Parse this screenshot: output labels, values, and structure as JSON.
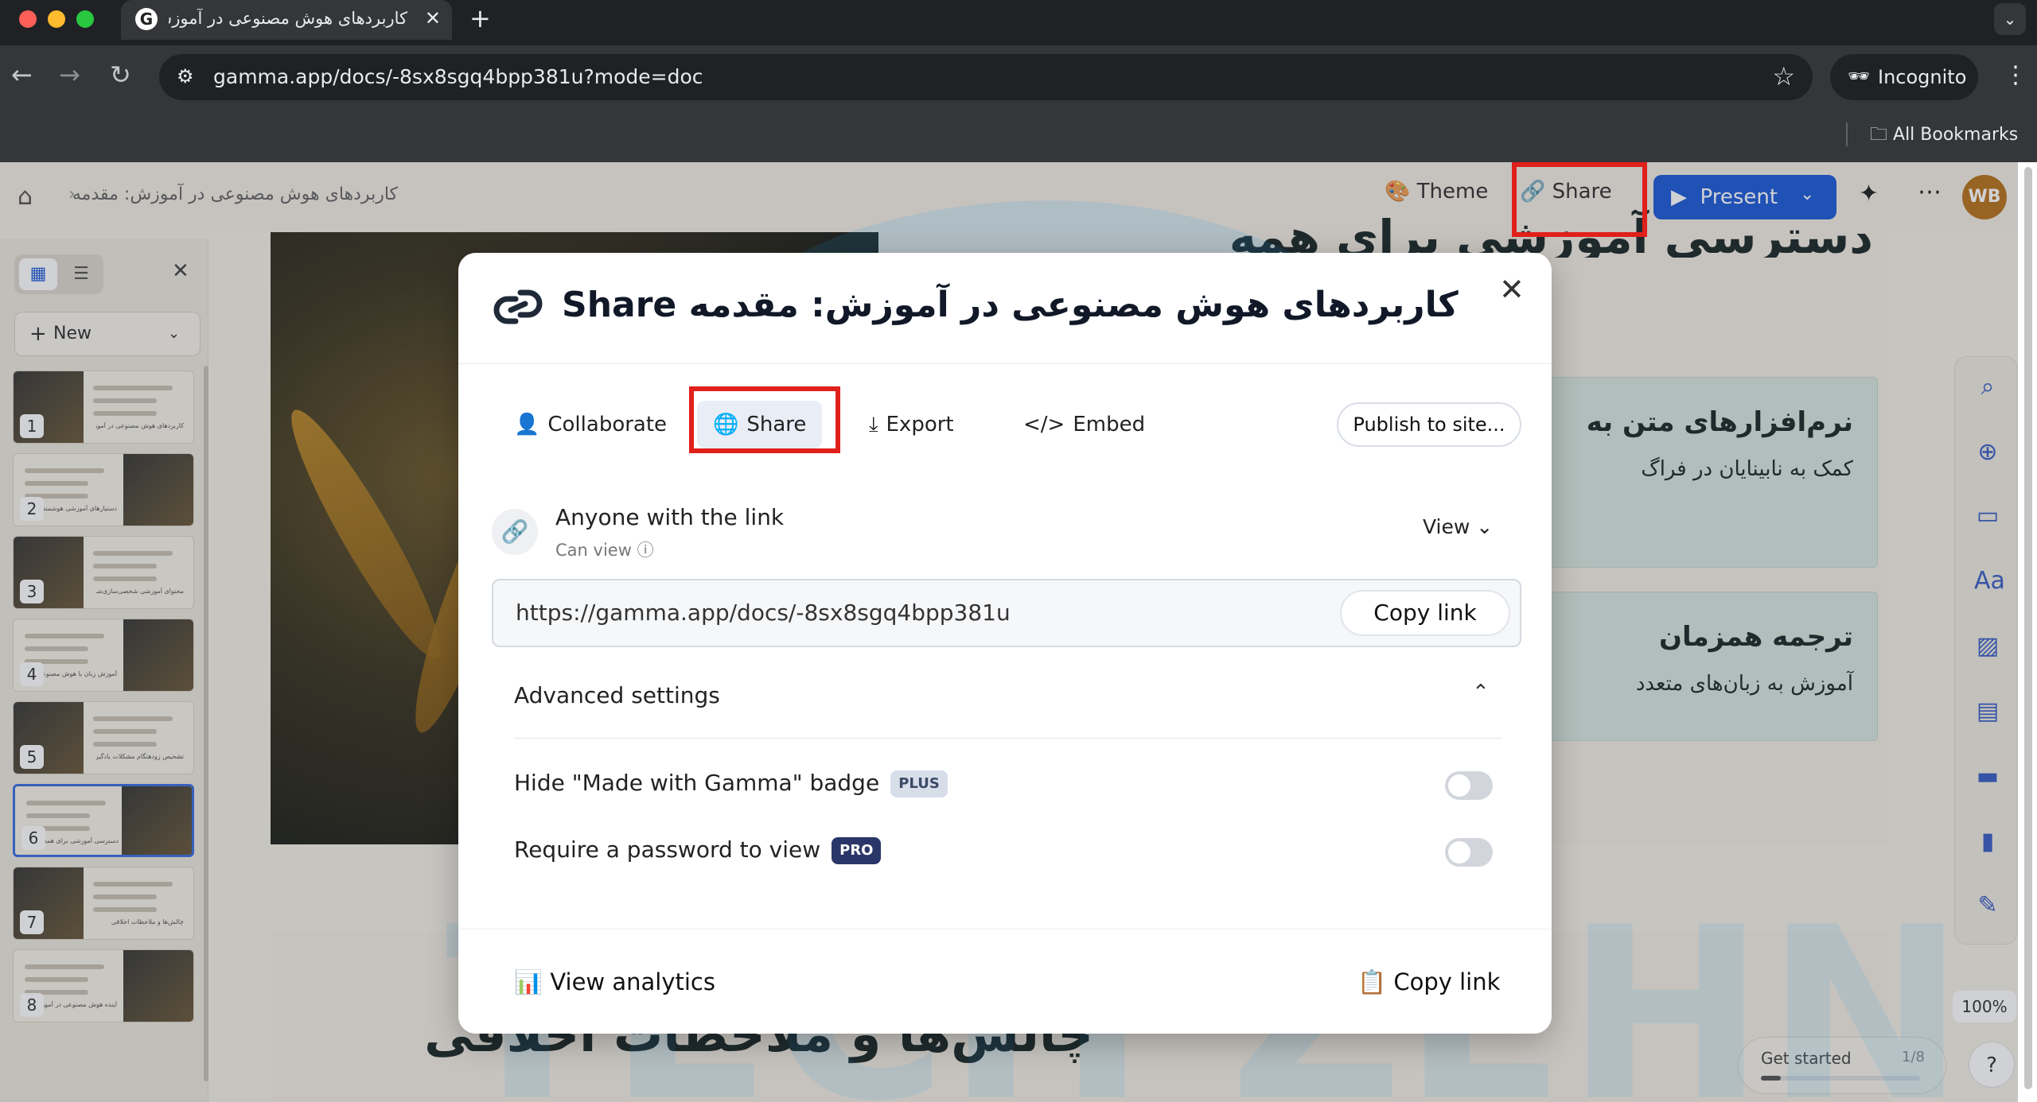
{
  "browser": {
    "tab_title": "کاربردهای هوش مصنوعی در آموزش: مقدمه",
    "tab_favicon": "G",
    "url": "gamma.app/docs/-8sx8sgq4bpp381u?mode=doc",
    "incognito_label": "Incognito",
    "bookmarks_label": "All Bookmarks"
  },
  "app": {
    "breadcrumb": "کاربردهای هوش مصنوعی در آموزش: مقدمه",
    "theme_label": "Theme",
    "share_label": "Share",
    "present_label": "Present",
    "avatar_initials": "WB",
    "zoom": "100%",
    "get_started_label": "Get started",
    "get_started_count": "1/8",
    "get_started_progress": 0.125,
    "help_label": "?"
  },
  "sidebar": {
    "new_label": "New",
    "slides": [
      {
        "num": "1",
        "caption": "کاربردهای هوش مصنوعی در آموزش: مقدمه"
      },
      {
        "num": "2",
        "caption": "دستیارهای آموزشی هوشمند"
      },
      {
        "num": "3",
        "caption": "محتوای آموزشی شخصی‌سازی‌شده"
      },
      {
        "num": "4",
        "caption": "آموزش زبان با هوش مصنوعی"
      },
      {
        "num": "5",
        "caption": "تشخیص زودهنگام مشکلات یادگیری"
      },
      {
        "num": "6",
        "caption": "دسترسی آموزشی برای همه"
      },
      {
        "num": "7",
        "caption": "چالش‌ها و ملاحظات اخلاقی"
      },
      {
        "num": "8",
        "caption": "آینده هوش مصنوعی در آموزش"
      }
    ]
  },
  "canvas": {
    "heading_top": "دسترسی آموزشی برای همه",
    "card1_title": "نرم‌افزارهای متن به",
    "card1_body": "کمک به نابینایان در فراگ",
    "card2_title": "ترجمه همزمان",
    "card2_body": "آموزش به زبان‌های متعدد",
    "lower_heading": "چالش‌ها و ملاحظات اخلاقی"
  },
  "modal": {
    "title": "Share کاربردهای هوش مصنوعی در آموزش: مقدمه",
    "tabs": {
      "collaborate": "Collaborate",
      "share": "Share",
      "export": "Export",
      "embed": "Embed"
    },
    "publish_label": "Publish to site...",
    "access_title": "Anyone with the link",
    "access_sub": "Can view",
    "permission": "View",
    "share_url": "https://gamma.app/docs/-8sx8sgq4bpp381u",
    "copy_link_label": "Copy link",
    "advanced_label": "Advanced settings",
    "settings": [
      {
        "label": "Hide \"Made with Gamma\" badge",
        "badge": "PLUS",
        "enabled": false
      },
      {
        "label": "Require a password to view",
        "badge": "PRO",
        "enabled": false
      }
    ],
    "analytics_label": "View analytics",
    "footer_copy_label": "Copy link"
  },
  "watermark": {
    "text": "TECH ZEHN",
    "color": "#1a9be6"
  },
  "colors": {
    "accent": "#1e5bd8",
    "highlight": "#e0201b"
  }
}
